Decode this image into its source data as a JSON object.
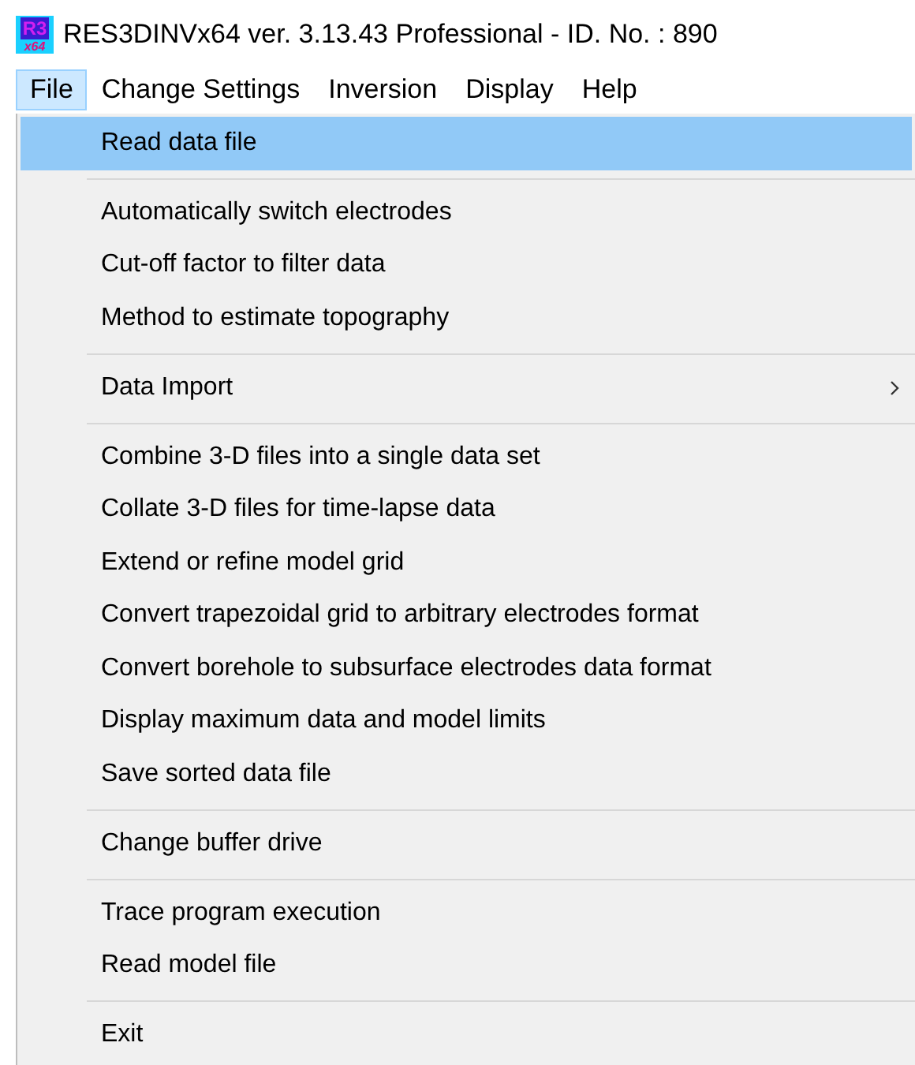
{
  "window": {
    "title": "RES3DINVx64 ver. 3.13.43 Professional - ID. No. : 890",
    "app_icon": {
      "top": "R3",
      "bottom": "x64"
    }
  },
  "menu_bar": [
    {
      "label": "File",
      "selected": true
    },
    {
      "label": "Change Settings",
      "selected": false
    },
    {
      "label": "Inversion",
      "selected": false
    },
    {
      "label": "Display",
      "selected": false
    },
    {
      "label": "Help",
      "selected": false
    }
  ],
  "file_menu": {
    "groups": [
      {
        "items": [
          {
            "label": "Read data file",
            "selected": true,
            "submenu": false
          }
        ]
      },
      {
        "items": [
          {
            "label": "Automatically switch electrodes",
            "selected": false,
            "submenu": false
          },
          {
            "label": "Cut-off factor to filter data",
            "selected": false,
            "submenu": false
          },
          {
            "label": "Method to estimate topography",
            "selected": false,
            "submenu": false
          }
        ]
      },
      {
        "items": [
          {
            "label": "Data Import",
            "selected": false,
            "submenu": true
          }
        ]
      },
      {
        "items": [
          {
            "label": "Combine 3-D files into a single data set",
            "selected": false,
            "submenu": false
          },
          {
            "label": "Collate 3-D files for time-lapse data",
            "selected": false,
            "submenu": false
          },
          {
            "label": "Extend or refine model grid",
            "selected": false,
            "submenu": false
          },
          {
            "label": "Convert trapezoidal grid to arbitrary electrodes format",
            "selected": false,
            "submenu": false
          },
          {
            "label": "Convert borehole to subsurface electrodes data format",
            "selected": false,
            "submenu": false
          },
          {
            "label": "Display maximum data and model limits",
            "selected": false,
            "submenu": false
          },
          {
            "label": "Save sorted data file",
            "selected": false,
            "submenu": false
          }
        ]
      },
      {
        "items": [
          {
            "label": "Change buffer drive",
            "selected": false,
            "submenu": false
          }
        ]
      },
      {
        "items": [
          {
            "label": "Trace program execution",
            "selected": false,
            "submenu": false
          },
          {
            "label": "Read model file",
            "selected": false,
            "submenu": false
          }
        ]
      },
      {
        "items": [
          {
            "label": "Exit",
            "selected": false,
            "submenu": false
          }
        ]
      }
    ]
  }
}
